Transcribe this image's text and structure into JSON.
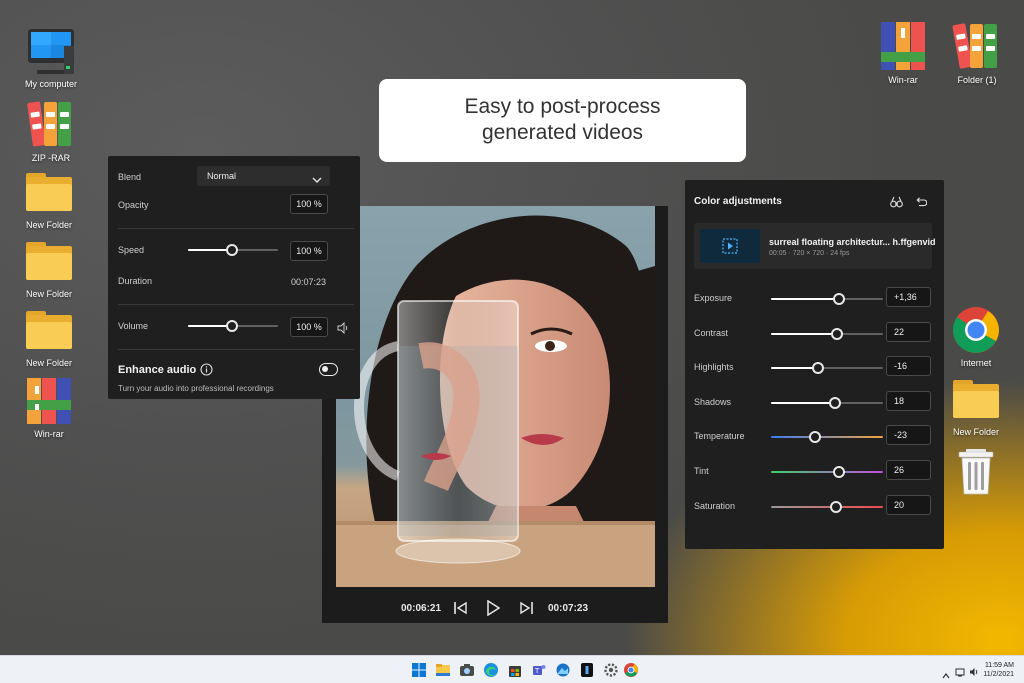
{
  "desktop": {
    "left_icons": [
      {
        "label": "My computer"
      },
      {
        "label": "ZIP -RAR"
      },
      {
        "label": "New Folder"
      },
      {
        "label": "New Folder"
      },
      {
        "label": "New Folder"
      },
      {
        "label": "Win-rar"
      }
    ],
    "right_icons": [
      {
        "label": "Win-rar"
      },
      {
        "label": "Folder (1)"
      },
      {
        "label": "Internet"
      },
      {
        "label": "New Folder"
      }
    ]
  },
  "headline": {
    "line1": "Easy to post-process",
    "line2": "generated videos"
  },
  "audio_panel": {
    "blend_label": "Blend",
    "blend_value": "Normal",
    "opacity_label": "Opacity",
    "opacity_value": "100 %",
    "speed_label": "Speed",
    "speed_value": "100 %",
    "speed_level": 0.49,
    "duration_label": "Duration",
    "duration_value": "00:07:23",
    "volume_label": "Volume",
    "volume_value": "100 %",
    "volume_level": 0.49,
    "enhance_title": "Enhance audio",
    "enhance_desc": "Turn your audio into professional recordings",
    "enhance_on": false
  },
  "player": {
    "current_time": "00:06:21",
    "total_time": "00:07:23"
  },
  "color_panel": {
    "title": "Color adjustments",
    "clip_name": "surreal floating architectur... h.ffgenvid",
    "clip_meta": "00:05 · 720 × 720 · 24 fps",
    "adjustments": [
      {
        "label": "Exposure",
        "value": "+1,36",
        "level": 0.61,
        "gradient": false
      },
      {
        "label": "Contrast",
        "value": "22",
        "level": 0.59,
        "gradient": false
      },
      {
        "label": "Highlights",
        "value": "-16",
        "level": 0.42,
        "gradient": false
      },
      {
        "label": "Shadows",
        "value": "18",
        "level": 0.57,
        "gradient": false
      },
      {
        "label": "Temperature",
        "value": "-23",
        "level": 0.39,
        "gradient": true,
        "colors": [
          "#3d7cf2",
          "#f2a23d"
        ]
      },
      {
        "label": "Tint",
        "value": "26",
        "level": 0.61,
        "gradient": true,
        "colors": [
          "#3fcf6a",
          "#c24ee0"
        ]
      },
      {
        "label": "Saturation",
        "value": "20",
        "level": 0.58,
        "gradient": true,
        "colors": [
          "#9a9a9a",
          "#f04b4b"
        ]
      }
    ]
  },
  "taskbar": {
    "time": "11:59 AM",
    "date": "11/2/2021"
  },
  "colors": {
    "panel_bg": "#1f1f1f",
    "headline_bg": "#ffffff",
    "taskbar_bg": "#eef1f6"
  }
}
